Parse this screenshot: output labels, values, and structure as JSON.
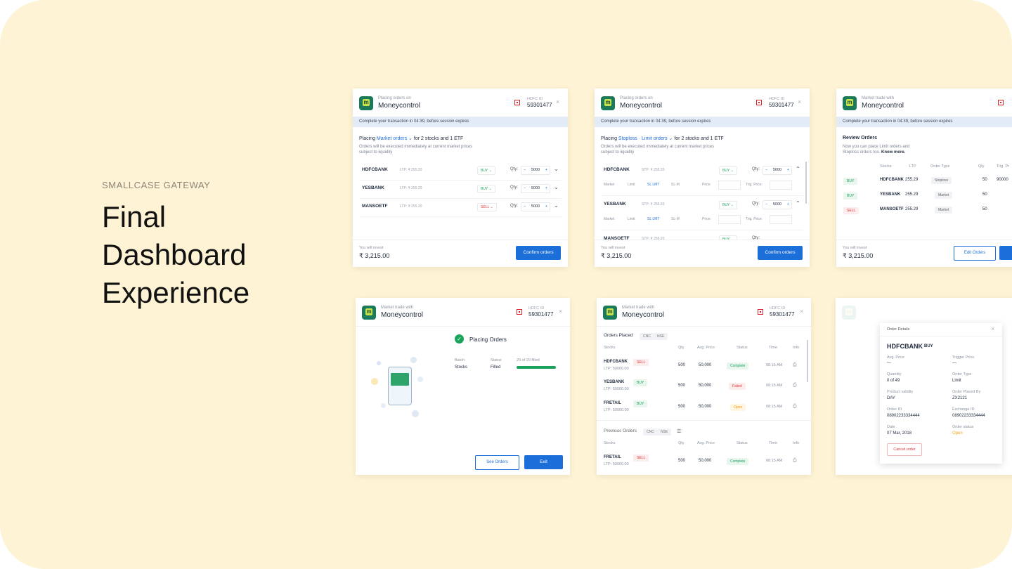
{
  "slide": {
    "eyebrow": "SMALLCASE GATEWAY",
    "title_lines": [
      "Final",
      "Dashboard",
      "Experience"
    ]
  },
  "common": {
    "app_name": "Moneycontrol",
    "placing_label": "Placing orders on",
    "market_trade_label": "Market trade with",
    "broker_id_label": "HDFC ID",
    "broker_id": "59301477",
    "session_banner": "Complete your transaction in 04:39, before session expires",
    "invest_label": "You will invest",
    "invest_amount": "₹ 3,215.00",
    "qty_label": "Qty:",
    "qty_value": "5000",
    "ltp": "LTP: ₹ 255.20",
    "close_icon": "close-icon",
    "logo_letter": "m"
  },
  "card1": {
    "placing_prefix": "Placing",
    "order_type": "Market orders ⌄",
    "placing_suffix": "for 2 stocks and 1 ETF",
    "note": "Orders will be executed immediately at current market prices subject to liquidity",
    "rows": [
      {
        "name": "HDFCBANK",
        "side": "BUY ⌄"
      },
      {
        "name": "YESBANK",
        "side": "BUY ⌄"
      },
      {
        "name": "MANSOETF",
        "side": "SELL ⌄"
      }
    ],
    "confirm_label": "Confirm orders"
  },
  "card2": {
    "placing_prefix": "Placing",
    "order_type": "Stoploss · Limit orders ⌄",
    "placing_suffix": "for 2 stocks and 1 ETF",
    "note": "Orders will be executed immediately at current market prices subject to liquidity",
    "rows": [
      {
        "name": "HDFCBANK",
        "side": "BUY ⌄"
      },
      {
        "name": "YESBANK",
        "side": "BUY ⌄"
      },
      {
        "name": "MANSOETF",
        "side": "BUY ⌄"
      }
    ],
    "ltp": "STP: ₹ 255.20",
    "options": [
      "Market",
      "Limit",
      "SL LMT",
      "SL-M"
    ],
    "price_label": "Price:",
    "trig_label": "Trig. Price:",
    "confirm_label": "Confirm orders"
  },
  "card3": {
    "title": "Review Orders",
    "note": "Now you can place Limit orders and Stoploss orders too.",
    "know_more": "Know more.",
    "headers": [
      "Stocks",
      "LTP",
      "Order Type",
      "Qty",
      "Trig. Pr"
    ],
    "rows": [
      {
        "side": "BUY",
        "name": "HDFCBANK",
        "ltp": "255.29",
        "type": "Stoploss",
        "qty": "50",
        "trig": "90000"
      },
      {
        "side": "BUY",
        "name": "YESBANK",
        "ltp": "255.29",
        "type": "Market",
        "qty": "50",
        "trig": ""
      },
      {
        "side": "SELL",
        "name": "MANSOETF",
        "ltp": "255.29",
        "type": "Market",
        "qty": "50",
        "trig": ""
      }
    ],
    "edit_label": "Edit Orders",
    "place_label": "P"
  },
  "card4": {
    "status_title": "Placing Orders",
    "col_batch": "Batch",
    "col_status": "Status",
    "row_label": "Stocks",
    "row_status": "Filled",
    "progress_text": "20 of 20 filled",
    "progress": 1.0,
    "see_orders": "See Orders",
    "exit": "Exit"
  },
  "card5": {
    "placed_title": "Orders Placed",
    "badges": [
      "CNC",
      "NSE"
    ],
    "headers": [
      "Stocks",
      "Qty",
      "Avg. Price",
      "Status",
      "Time",
      "Info"
    ],
    "rows": [
      {
        "name": "HDFCBANK",
        "side": "SELL",
        "ltp": "LTP: 50000.00",
        "qty": "500",
        "avg": "50,000",
        "status": "Complete",
        "time": "08:15 AM"
      },
      {
        "name": "YESBANK",
        "side": "BUY",
        "ltp": "LTP: 50000.00",
        "qty": "500",
        "avg": "50,000",
        "status": "Failed",
        "time": "08:15 AM"
      },
      {
        "name": "FRETAIL",
        "side": "BUY",
        "ltp": "LTP: 50000.00",
        "qty": "500",
        "avg": "50,000",
        "status": "Open",
        "time": "08:15 AM"
      }
    ],
    "previous_title": "Previous Orders",
    "prev_rows": [
      {
        "name": "FRETAIL",
        "side": "SELL",
        "ltp": "LTP: 50000.00",
        "qty": "500",
        "avg": "50,000",
        "status": "Complete",
        "time": "08:15 AM"
      }
    ]
  },
  "card6": {
    "modal_title": "Order Details",
    "stock": "HDFCBANK",
    "side": "BUY",
    "fields": [
      {
        "label": "Avg. Price",
        "value": "—"
      },
      {
        "label": "Trigger Price",
        "value": "—"
      },
      {
        "label": "Quantity",
        "value": "0 of 49"
      },
      {
        "label": "Order Type",
        "value": "Limit"
      },
      {
        "label": "Product validity",
        "value": "DAY"
      },
      {
        "label": "Order Placed By",
        "value": "ZX2121"
      },
      {
        "label": "Order ID",
        "value": "08902233334444"
      },
      {
        "label": "Exchange ID",
        "value": "08902233334444"
      },
      {
        "label": "Date",
        "value": "07 Mar, 2018"
      },
      {
        "label": "Order status",
        "value": "Open"
      }
    ],
    "cancel_label": "Cancel order"
  },
  "colors": {
    "background": "#fef3d4",
    "primary": "#1c6fd8",
    "buy": "#19a35b",
    "sell": "#e0363c"
  }
}
